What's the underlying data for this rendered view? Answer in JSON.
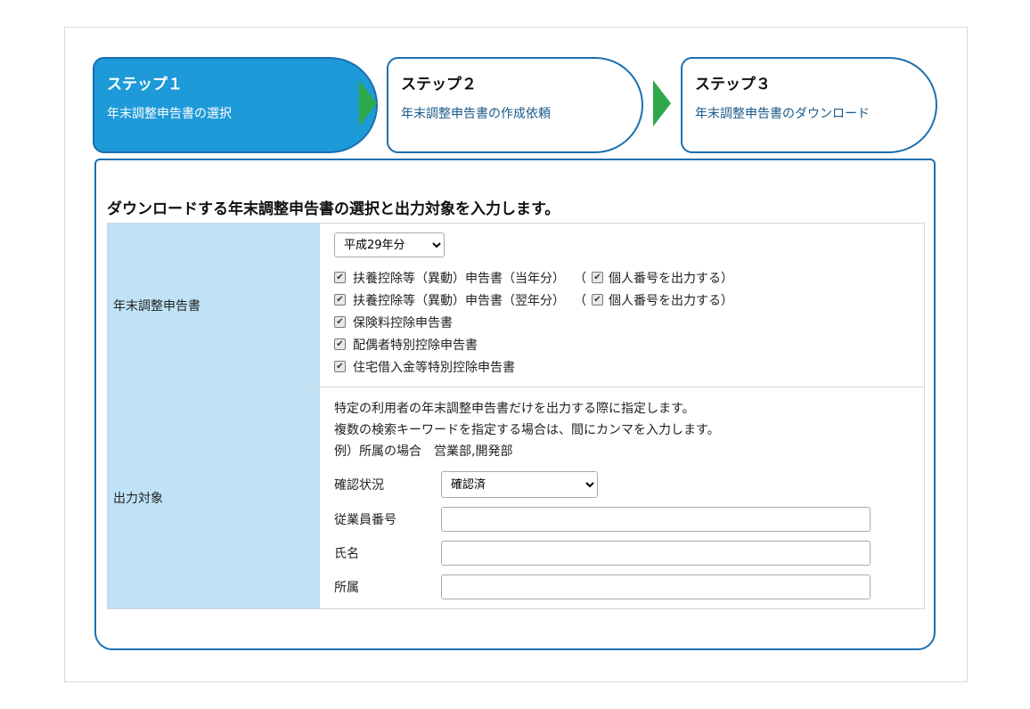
{
  "steps": [
    {
      "title": "ステップ１",
      "subtitle": "年末調整申告書の選択"
    },
    {
      "title": "ステップ２",
      "subtitle": "年末調整申告書の作成依頼"
    },
    {
      "title": "ステップ３",
      "subtitle": "年末調整申告書のダウンロード"
    }
  ],
  "colors": {
    "active_step": "#1e9ad8",
    "border": "#1a6fb0",
    "arrow": "#2ea84a",
    "label_bg": "#bfe2f7"
  },
  "heading": "ダウンロードする年末調整申告書の選択と出力対象を入力します。",
  "forms_row": {
    "label": "年末調整申告書",
    "year_select": {
      "value": "平成29年分"
    },
    "checkboxes": [
      {
        "label": "扶養控除等（異動）申告書（当年分）",
        "checked": true,
        "sub_label": "個人番号を出力する）",
        "sub_checked": true
      },
      {
        "label": "扶養控除等（異動）申告書（翌年分）",
        "checked": true,
        "sub_label": "個人番号を出力する）",
        "sub_checked": true
      },
      {
        "label": "保険料控除申告書",
        "checked": true
      },
      {
        "label": "配偶者特別控除申告書",
        "checked": true
      },
      {
        "label": "住宅借入金等特別控除申告書",
        "checked": true
      }
    ]
  },
  "target_row": {
    "label": "出力対象",
    "description": [
      "特定の利用者の年末調整申告書だけを出力する際に指定します。",
      "複数の検索キーワードを指定する場合は、間にカンマを入力します。",
      "例）所属の場合　営業部,開発部"
    ],
    "status": {
      "label": "確認状況",
      "value": "確認済"
    },
    "employee_number": {
      "label": "従業員番号",
      "value": ""
    },
    "name": {
      "label": "氏名",
      "value": ""
    },
    "department": {
      "label": "所属",
      "value": ""
    }
  }
}
